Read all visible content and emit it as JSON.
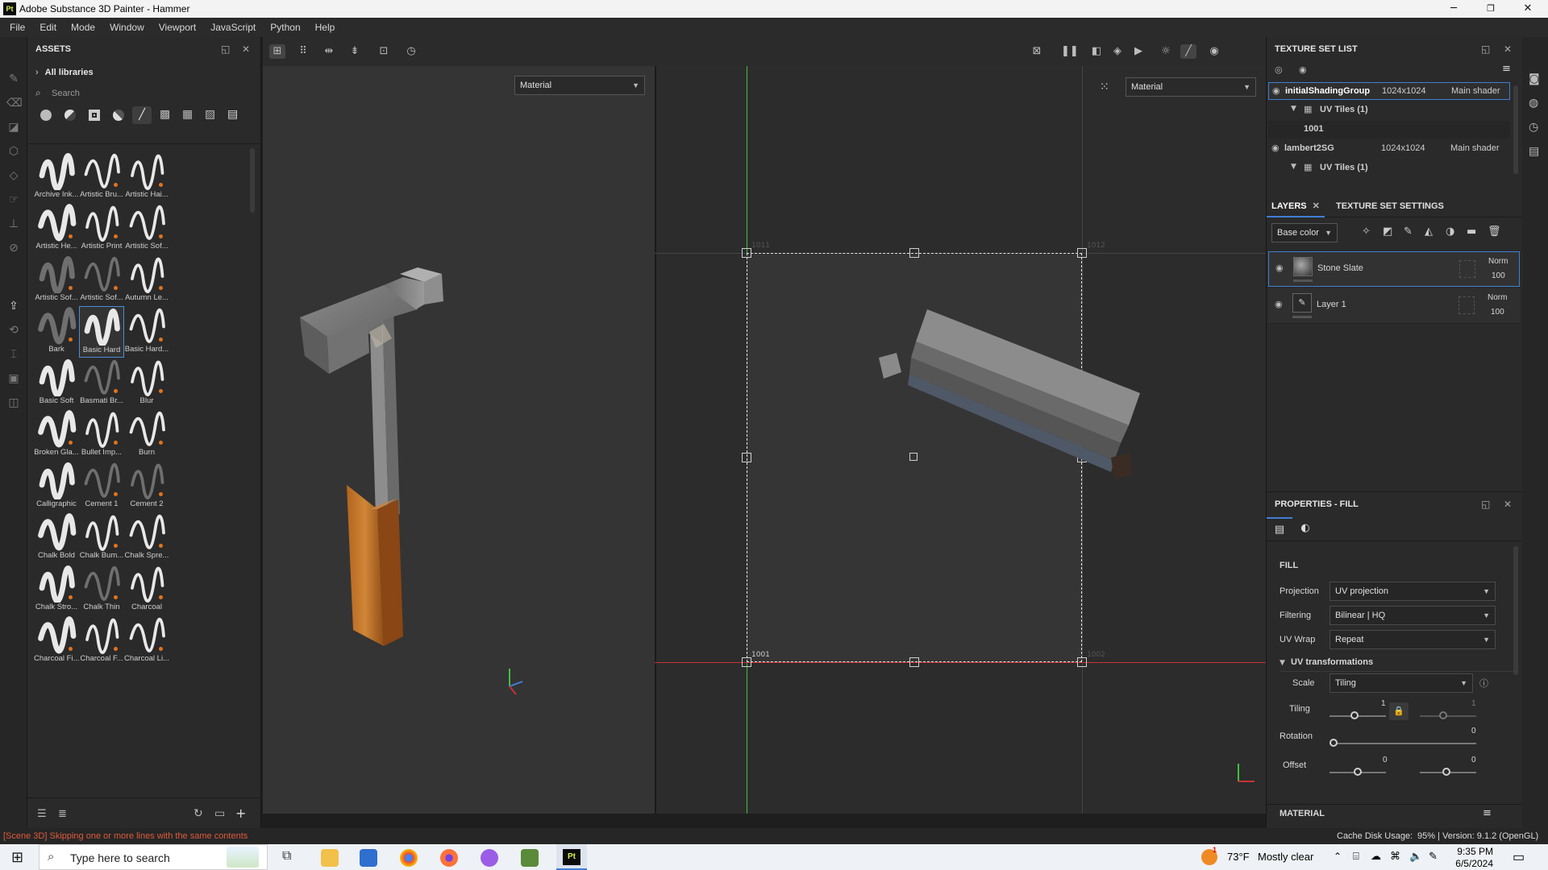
{
  "app": {
    "title": "Adobe Substance 3D Painter - Hammer",
    "logo": "Pt",
    "menu": [
      "File",
      "Edit",
      "Mode",
      "Window",
      "Viewport",
      "JavaScript",
      "Python",
      "Help"
    ],
    "window_controls": {
      "minimize": "─",
      "maximize": "❐",
      "close": "✕"
    }
  },
  "assets": {
    "title": "ASSETS",
    "library": "All libraries",
    "search_placeholder": "Search",
    "items": [
      {
        "label": "Archive Ink..."
      },
      {
        "label": "Artistic Bru..."
      },
      {
        "label": "Artistic Hai..."
      },
      {
        "label": "Artistic He..."
      },
      {
        "label": "Artistic Print"
      },
      {
        "label": "Artistic Sof..."
      },
      {
        "label": "Artistic Sof..."
      },
      {
        "label": "Artistic Sof..."
      },
      {
        "label": "Autumn Le..."
      },
      {
        "label": "Bark"
      },
      {
        "label": "Basic Hard"
      },
      {
        "label": "Basic Hard..."
      },
      {
        "label": "Basic Soft"
      },
      {
        "label": "Basmati Br..."
      },
      {
        "label": "Blur"
      },
      {
        "label": "Broken Gla..."
      },
      {
        "label": "Bullet Imp..."
      },
      {
        "label": "Burn"
      },
      {
        "label": "Calligraphic"
      },
      {
        "label": "Cement 1"
      },
      {
        "label": "Cement 2"
      },
      {
        "label": "Chalk Bold"
      },
      {
        "label": "Chalk Bum..."
      },
      {
        "label": "Chalk Spre..."
      },
      {
        "label": "Chalk Stro..."
      },
      {
        "label": "Chalk Thin"
      },
      {
        "label": "Charcoal"
      },
      {
        "label": "Charcoal Fi..."
      },
      {
        "label": "Charcoal F..."
      },
      {
        "label": "Charcoal Li..."
      }
    ],
    "selected": "Basic Hard"
  },
  "viewport": {
    "left_mode": "Material",
    "right_mode": "Material",
    "uv_tile_labels": [
      "1011",
      "1012",
      "1001",
      "1002"
    ]
  },
  "texture_set_list": {
    "title": "TEXTURE SET LIST",
    "sets": [
      {
        "name": "initialShadingGroup",
        "res": "1024x1024",
        "shader": "Main shader",
        "tiles": "UV Tiles (1)",
        "tile_id": "1001"
      },
      {
        "name": "lambert2SG",
        "res": "1024x1024",
        "shader": "Main shader",
        "tiles": "UV Tiles (1)"
      }
    ]
  },
  "layers": {
    "tab_layers": "LAYERS",
    "tab_settings": "TEXTURE SET SETTINGS",
    "channel": "Base color",
    "items": [
      {
        "name": "Stone Slate",
        "blend": "Norm",
        "opacity": "100"
      },
      {
        "name": "Layer 1",
        "blend": "Norm",
        "opacity": "100"
      }
    ]
  },
  "properties": {
    "title": "PROPERTIES - FILL",
    "section": "FILL",
    "projection_label": "Projection",
    "projection": "UV projection",
    "filtering_label": "Filtering",
    "filtering": "Bilinear | HQ",
    "uvwrap_label": "UV Wrap",
    "uvwrap": "Repeat",
    "uvtrans": "UV transformations",
    "scale_label": "Scale",
    "scale": "Tiling",
    "tiling_label": "Tiling",
    "tiling_u": "1",
    "tiling_v": "1",
    "rotation_label": "Rotation",
    "rotation": "0",
    "offset_label": "Offset",
    "offset_u": "0",
    "offset_v": "0",
    "material": "MATERIAL"
  },
  "status": {
    "message": "[Scene 3D] Skipping one or more lines with the same contents",
    "cache": "Cache Disk Usage:",
    "cache_val": "95% | Version: 9.1.2 (OpenGL)"
  },
  "taskbar": {
    "search_placeholder": "Type here to search",
    "weather_temp": "73°F",
    "weather_desc": "Mostly clear",
    "time": "9:35 PM",
    "date": "6/5/2024",
    "weather_badge": "1"
  },
  "colors": {
    "accent": "#3f7fd4",
    "brand": "#d6f24b",
    "green_axis": "#3fbf3f",
    "red_axis": "#c83232",
    "badge": "#e0731f"
  }
}
